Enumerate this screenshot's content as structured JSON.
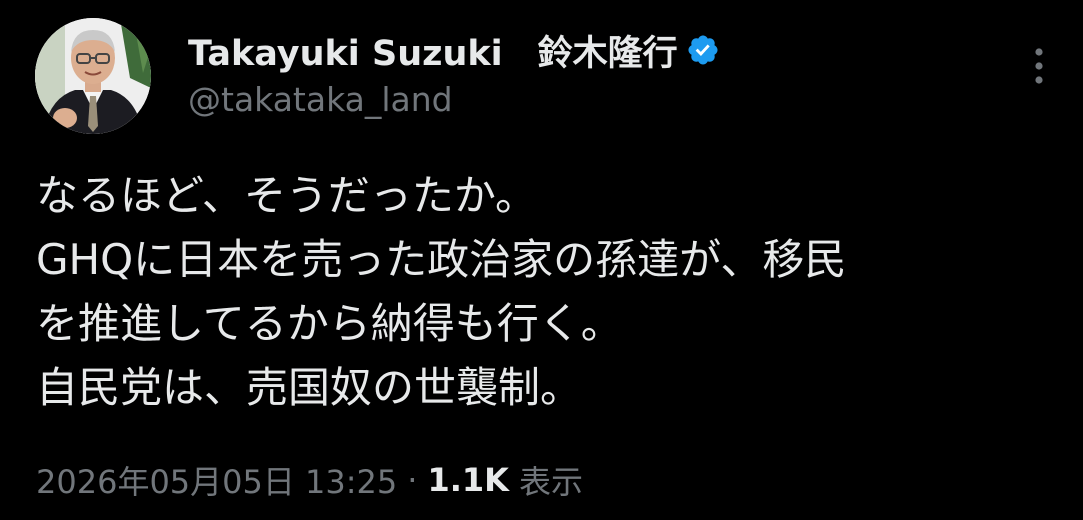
{
  "author": {
    "display_name": "Takayuki Suzuki　鈴木隆行",
    "handle": "@takataka_land",
    "verified_icon": "verified-badge-icon"
  },
  "tweet": {
    "lines": [
      "なるほど、そうだったか。",
      "GHQに日本を売った政治家の孫達が、移民",
      "を推進してるから納得も行く。",
      "自民党は、売国奴の世襲制。"
    ]
  },
  "meta": {
    "timestamp": "2026年05月05日 13:25",
    "separator": "·",
    "views_count": "1.1K",
    "views_label": "表示"
  },
  "colors": {
    "background": "#000000",
    "primary_text": "#e7e9ea",
    "secondary_text": "#71767b",
    "verified_blue": "#1d9bf0"
  },
  "icons": {
    "more": "more-vertical-icon"
  }
}
